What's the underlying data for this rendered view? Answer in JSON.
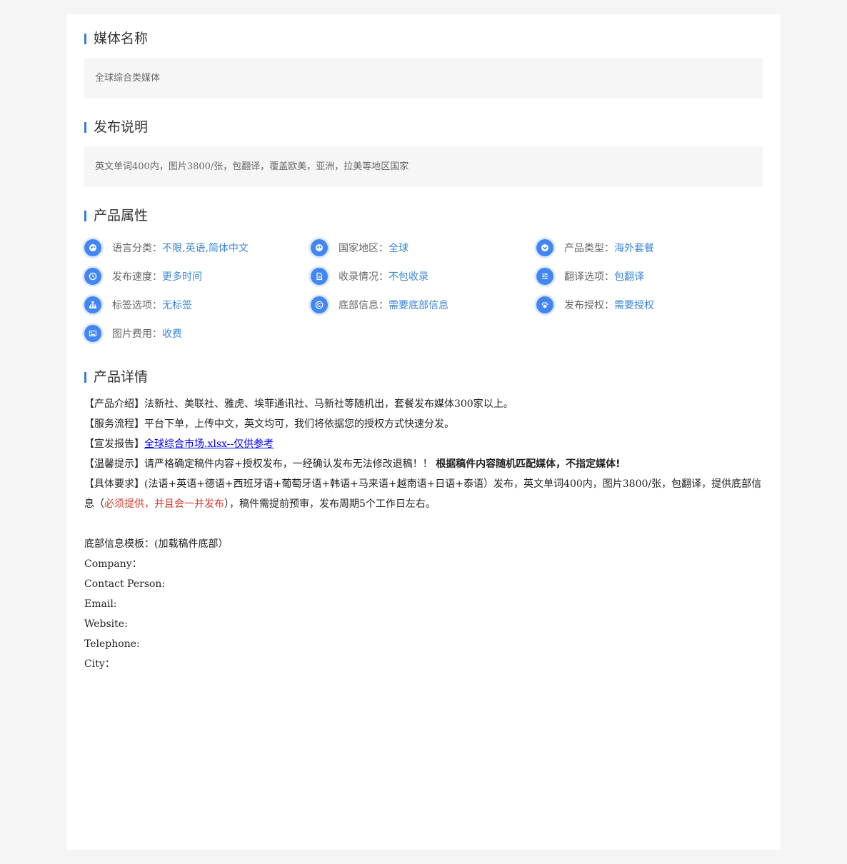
{
  "media_name": {
    "title": "媒体名称",
    "value": "全球综合类媒体"
  },
  "publish_note": {
    "title": "发布说明",
    "value": "英文单词400内，图片3800/张，包翻译，覆盖欧美，亚洲，拉美等地区国家"
  },
  "attributes": {
    "title": "产品属性",
    "items": [
      {
        "icon": "globe-icon",
        "label": "语言分类：",
        "value": "不限,英语,简体中文"
      },
      {
        "icon": "globe-icon",
        "label": "国家地区：",
        "value": "全球"
      },
      {
        "icon": "chevron-down-circle-icon",
        "label": "产品类型：",
        "value": "海外套餐"
      },
      {
        "icon": "clock-icon",
        "label": "发布速度：",
        "value": "更多时间"
      },
      {
        "icon": "document-icon",
        "label": "收录情况：",
        "value": "不包收录"
      },
      {
        "icon": "sliders-icon",
        "label": "翻译选项：",
        "value": "包翻译"
      },
      {
        "icon": "sitemap-icon",
        "label": "标签选项：",
        "value": "无标签"
      },
      {
        "icon": "copyright-icon",
        "label": "底部信息：",
        "value": "需要底部信息"
      },
      {
        "icon": "paw-icon",
        "label": "发布授权：",
        "value": "需要授权"
      },
      {
        "icon": "image-icon",
        "label": "图片费用：",
        "value": "收费"
      }
    ]
  },
  "details": {
    "title": "产品详情",
    "intro": "【产品介绍】法新社、美联社、雅虎、埃菲通讯社、马新社等随机出，套餐发布媒体300家以上。",
    "process": "【服务流程】平台下单，上传中文，英文均可，我们将依据您的授权方式快速分发。",
    "report_prefix": "【宣发报告】",
    "report_link": "全球综合市场.xlsx--仅供参考",
    "tip_prefix": "【温馨提示】请严格确定稿件内容+授权发布，一经确认发布无法修改退稿！！",
    "tip_bold": "根据稿件内容随机匹配媒体，不指定媒体!",
    "req_prefix": "【具体要求】(法语+英语+德语+西班牙语+葡萄牙语+韩语+马来语+越南语+日语+泰语）发布，英文单词400内，图片3800/张，包翻译，提供底部信息（",
    "req_red": "必须提供，并且会一并发布",
    "req_suffix": "），稿件需提前预审，发布周期5个工作日左右。",
    "footer_template": "底部信息模板：(加载稿件底部）",
    "company": "Company：",
    "contact": "Contact Person:",
    "email": "Email:",
    "website": "Website:",
    "telephone": "Telephone:",
    "city": "City："
  },
  "colors": {
    "accent": "#3a7bd5",
    "link_value": "#3a86d8",
    "icon_bg": "#4285f4",
    "warning_red": "#d03b2b"
  }
}
